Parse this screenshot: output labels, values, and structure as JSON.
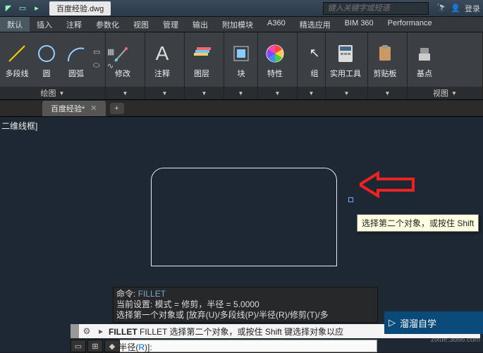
{
  "titlebar": {
    "filename": "百度经验.dwg",
    "search_placeholder": "键入关键字或短语",
    "login": "登录"
  },
  "ribbon_tabs": [
    "默认",
    "插入",
    "注释",
    "参数化",
    "视图",
    "管理",
    "输出",
    "附加模块",
    "A360",
    "精选应用",
    "BIM 360",
    "Performance"
  ],
  "panels": {
    "draw": {
      "title": "绘图",
      "line": "直线",
      "polyline": "多段线",
      "circle": "圆",
      "arc": "圆弧"
    },
    "modify": {
      "title": "修改",
      "label": "修改"
    },
    "annot": {
      "title": "注释",
      "label": "注释"
    },
    "layers": {
      "title": "图层",
      "label": "图层"
    },
    "block": {
      "title": "块",
      "label": "块"
    },
    "props": {
      "title": "特性",
      "label": "特性"
    },
    "group": {
      "title": "组",
      "label": "组"
    },
    "util": {
      "title": "实用工具",
      "label": "实用工具"
    },
    "clip": {
      "title": "剪贴板",
      "label": "剪贴板"
    },
    "base": {
      "title": "基点",
      "label": "基点"
    },
    "view": {
      "title": "视图"
    }
  },
  "filetab": {
    "name": "百度经验*"
  },
  "badge": "二维线框]",
  "tooltip": "选择第二个对象，或按住 Shift ",
  "cmd_history": {
    "l1_a": "命令:",
    "l1_b": "FILLET",
    "l2": "当前设置: 模式 = 修剪，半径 = 5.0000",
    "l3": "选择第一个对象或 [放弃(U)/多段线(P)/半径(R)/修剪(T)/多"
  },
  "cmdline": {
    "prefix": "FILLET 选择第二个对象，或按住 Shift 键选择对象以应"
  },
  "cmdinput": {
    "a": "[半径(",
    "r": "R",
    "b": ")]:"
  },
  "watermark": {
    "text": "溜溜自学",
    "url": "zixue.3d66.com"
  }
}
